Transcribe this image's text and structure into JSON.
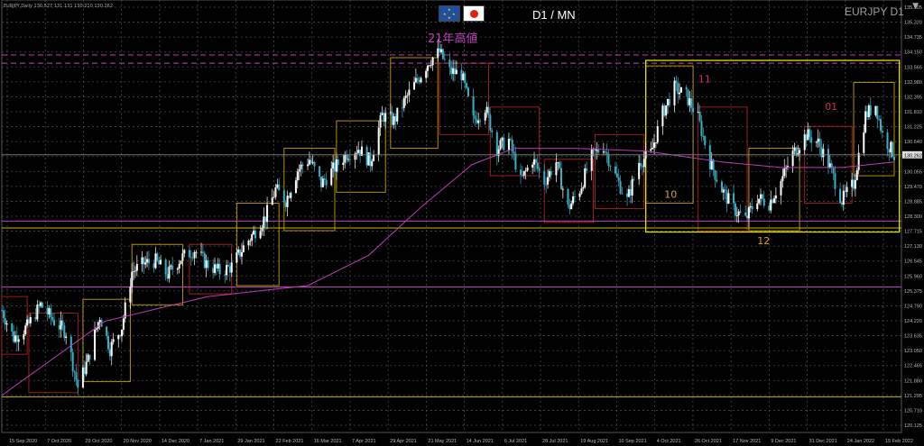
{
  "header": {
    "info_line": "EURJPY,Daily 130.527 131.131 130.210 130.262",
    "title": "D1 / MN",
    "symbol": "EURJPY D1",
    "window_control": "▼"
  },
  "colors": {
    "background": "#000000",
    "candle_bull": "#ffffff",
    "candle_bear": "#3ab0c8",
    "moving_average": "#c03ab8",
    "yellow_line": "#c8b400",
    "magenta_line": "#c040c0",
    "monthly_box": "#c8a000",
    "monthly_box_red": "#b02020",
    "range_box": "#e0e000",
    "grid": "#4a4a4a"
  },
  "chart_data": {
    "type": "candlestick",
    "symbol": "EURJPY",
    "timeframe": "Daily",
    "ylim": [
      120.15,
      135.9
    ],
    "x_range": [
      "2020-09-15",
      "2022-02-25"
    ],
    "y_ticks": [
      "135.905",
      "135.320",
      "134.735",
      "134.150",
      "133.565",
      "132.980",
      "132.395",
      "131.810",
      "131.225",
      "130.640",
      "130.262",
      "130.055",
      "129.470",
      "128.885",
      "128.300",
      "127.715",
      "127.130",
      "126.545",
      "125.960",
      "125.375",
      "124.790",
      "124.220",
      "123.635",
      "123.050",
      "122.465",
      "121.880",
      "121.295",
      "120.710",
      "120.125"
    ],
    "x_ticks": [
      "15 Sep 2020",
      "7 Oct 2020",
      "29 Oct 2020",
      "20 Nov 2020",
      "14 Dec 2020",
      "7 Jan 2021",
      "29 Jan 2021",
      "22 Feb 2021",
      "16 Mar 2021",
      "7 Apr 2021",
      "29 Apr 2021",
      "21 May 2021",
      "14 Jun 2021",
      "6 Jul 2021",
      "28 Jul 2021",
      "19 Aug 2021",
      "10 Sep 2021",
      "4 Oct 2021",
      "26 Oct 2021",
      "17 Nov 2021",
      "9 Dec 2021",
      "31 Dec 2021",
      "24 Jan 2022",
      "15 Feb 2022"
    ],
    "close_path": [
      [
        "2020-09-15",
        124.6
      ],
      [
        "2020-09-22",
        123.6
      ],
      [
        "2020-09-30",
        124.0
      ],
      [
        "2020-10-08",
        124.8
      ],
      [
        "2020-10-16",
        124.2
      ],
      [
        "2020-10-23",
        123.8
      ],
      [
        "2020-10-30",
        121.8
      ],
      [
        "2020-11-05",
        122.8
      ],
      [
        "2020-11-12",
        124.4
      ],
      [
        "2020-11-18",
        123.2
      ],
      [
        "2020-11-25",
        124.0
      ],
      [
        "2020-12-01",
        126.0
      ],
      [
        "2020-12-08",
        126.3
      ],
      [
        "2020-12-15",
        126.4
      ],
      [
        "2020-12-22",
        125.9
      ],
      [
        "2020-12-30",
        126.5
      ],
      [
        "2021-01-07",
        126.8
      ],
      [
        "2021-01-14",
        126.3
      ],
      [
        "2021-01-22",
        126.0
      ],
      [
        "2021-01-29",
        126.2
      ],
      [
        "2021-02-05",
        126.9
      ],
      [
        "2021-02-12",
        127.5
      ],
      [
        "2021-02-18",
        128.0
      ],
      [
        "2021-02-24",
        129.0
      ],
      [
        "2021-03-02",
        128.6
      ],
      [
        "2021-03-09",
        129.7
      ],
      [
        "2021-03-16",
        130.1
      ],
      [
        "2021-03-23",
        129.2
      ],
      [
        "2021-03-31",
        129.8
      ],
      [
        "2021-04-07",
        130.3
      ],
      [
        "2021-04-14",
        130.5
      ],
      [
        "2021-04-21",
        130.0
      ],
      [
        "2021-04-28",
        131.7
      ],
      [
        "2021-05-05",
        131.5
      ],
      [
        "2021-05-12",
        132.3
      ],
      [
        "2021-05-19",
        133.0
      ],
      [
        "2021-05-26",
        133.7
      ],
      [
        "2021-06-01",
        134.0
      ],
      [
        "2021-06-07",
        133.3
      ],
      [
        "2021-06-14",
        133.2
      ],
      [
        "2021-06-21",
        131.5
      ],
      [
        "2021-06-28",
        132.0
      ],
      [
        "2021-07-05",
        130.5
      ],
      [
        "2021-07-12",
        130.8
      ],
      [
        "2021-07-19",
        129.3
      ],
      [
        "2021-07-26",
        130.1
      ],
      [
        "2021-08-02",
        129.3
      ],
      [
        "2021-08-09",
        130.0
      ],
      [
        "2021-08-16",
        128.3
      ],
      [
        "2021-08-23",
        129.0
      ],
      [
        "2021-08-30",
        130.2
      ],
      [
        "2021-09-06",
        130.6
      ],
      [
        "2021-09-13",
        129.5
      ],
      [
        "2021-09-20",
        128.6
      ],
      [
        "2021-09-27",
        130.0
      ],
      [
        "2021-10-04",
        130.3
      ],
      [
        "2021-10-11",
        131.8
      ],
      [
        "2021-10-18",
        132.7
      ],
      [
        "2021-10-25",
        132.4
      ],
      [
        "2021-11-01",
        131.6
      ],
      [
        "2021-11-08",
        130.0
      ],
      [
        "2021-11-15",
        129.0
      ],
      [
        "2021-11-22",
        128.3
      ],
      [
        "2021-11-29",
        127.9
      ],
      [
        "2021-12-06",
        128.7
      ],
      [
        "2021-12-13",
        128.5
      ],
      [
        "2021-12-20",
        129.3
      ],
      [
        "2021-12-27",
        130.3
      ],
      [
        "2022-01-04",
        131.0
      ],
      [
        "2022-01-11",
        130.7
      ],
      [
        "2022-01-18",
        129.8
      ],
      [
        "2022-01-25",
        128.6
      ],
      [
        "2022-02-01",
        129.2
      ],
      [
        "2022-02-08",
        131.7
      ],
      [
        "2022-02-14",
        132.1
      ],
      [
        "2022-02-18",
        131.0
      ],
      [
        "2022-02-25",
        130.26
      ]
    ],
    "moving_average": [
      [
        "2020-09-15",
        121.5
      ],
      [
        "2020-11-15",
        124.2
      ],
      [
        "2021-01-15",
        125.1
      ],
      [
        "2021-03-15",
        125.5
      ],
      [
        "2021-04-20",
        126.6
      ],
      [
        "2021-05-20",
        128.3
      ],
      [
        "2021-06-20",
        129.9
      ],
      [
        "2021-07-15",
        130.5
      ],
      [
        "2021-08-20",
        130.5
      ],
      [
        "2021-10-01",
        130.4
      ],
      [
        "2021-11-15",
        130.0
      ],
      [
        "2021-12-20",
        129.8
      ],
      [
        "2022-01-25",
        129.8
      ],
      [
        "2022-02-25",
        130.0
      ]
    ],
    "current_price": 130.262,
    "horizontal_levels": [
      {
        "price": 133.9,
        "color": "magenta",
        "style": "dashed"
      },
      {
        "price": 133.6,
        "color": "magenta",
        "style": "dashed"
      },
      {
        "price": 127.85,
        "color": "magenta",
        "style": "solid"
      },
      {
        "price": 127.6,
        "color": "yellow",
        "style": "solid"
      },
      {
        "price": 125.45,
        "color": "magenta",
        "style": "solid"
      },
      {
        "price": 121.45,
        "color": "yellow",
        "style": "solid"
      }
    ],
    "range_box": {
      "x0": "2021-10-01",
      "x1": "2022-02-28",
      "y0": 127.45,
      "y1": 133.7
    },
    "monthly_boxes": [
      {
        "x0": "2020-09-15",
        "x1": "2020-09-30",
        "y0": 123.0,
        "y1": 125.1,
        "color": "red"
      },
      {
        "x0": "2020-10-01",
        "x1": "2020-10-30",
        "y0": 121.6,
        "y1": 124.5,
        "color": "red"
      },
      {
        "x0": "2020-11-02",
        "x1": "2020-11-30",
        "y0": 122.0,
        "y1": 125.0,
        "color": "gold"
      },
      {
        "x0": "2020-12-01",
        "x1": "2020-12-31",
        "y0": 124.8,
        "y1": 127.0,
        "color": "gold"
      },
      {
        "x0": "2021-01-04",
        "x1": "2021-01-29",
        "y0": 125.2,
        "y1": 127.0,
        "color": "red"
      },
      {
        "x0": "2021-02-01",
        "x1": "2021-02-26",
        "y0": 125.5,
        "y1": 128.5,
        "color": "gold"
      },
      {
        "x0": "2021-03-01",
        "x1": "2021-03-31",
        "y0": 127.5,
        "y1": 130.5,
        "color": "gold"
      },
      {
        "x0": "2021-04-01",
        "x1": "2021-04-30",
        "y0": 128.9,
        "y1": 131.5,
        "color": "gold"
      },
      {
        "x0": "2021-05-03",
        "x1": "2021-05-31",
        "y0": 130.5,
        "y1": 133.8,
        "color": "gold"
      },
      {
        "x0": "2021-06-01",
        "x1": "2021-06-30",
        "y0": 131.0,
        "y1": 133.6,
        "color": "red"
      },
      {
        "x0": "2021-07-01",
        "x1": "2021-07-30",
        "y0": 129.5,
        "y1": 132.0,
        "color": "red"
      },
      {
        "x0": "2021-08-02",
        "x1": "2021-08-31",
        "y0": 127.8,
        "y1": 130.1,
        "color": "red"
      },
      {
        "x0": "2021-09-01",
        "x1": "2021-09-30",
        "y0": 128.3,
        "y1": 131.0,
        "color": "red"
      },
      {
        "x0": "2021-10-01",
        "x1": "2021-10-29",
        "y0": 128.5,
        "y1": 133.5,
        "color": "gold"
      },
      {
        "x0": "2021-11-01",
        "x1": "2021-11-30",
        "y0": 127.5,
        "y1": 132.0,
        "color": "red"
      },
      {
        "x0": "2021-12-01",
        "x1": "2021-12-31",
        "y0": 127.5,
        "y1": 130.5,
        "color": "gold"
      },
      {
        "x0": "2022-01-03",
        "x1": "2022-01-31",
        "y0": 128.5,
        "y1": 131.3,
        "color": "red"
      },
      {
        "x0": "2022-02-01",
        "x1": "2022-02-25",
        "y0": 129.5,
        "y1": 132.9,
        "color": "gold"
      }
    ],
    "annotations": [
      {
        "text": "21年高値",
        "date": "2021-05-25",
        "price": 134.35,
        "color": "#c040c0"
      },
      {
        "text": "11",
        "date": "2021-11-01",
        "price": 132.9,
        "color": "#d03050"
      },
      {
        "text": "10",
        "date": "2021-10-12",
        "price": 128.7,
        "color": "#e0a020"
      },
      {
        "text": "01",
        "date": "2022-01-15",
        "price": 131.9,
        "color": "#d03050"
      },
      {
        "text": "12",
        "date": "2021-12-06",
        "price": 127.0,
        "color": "#e0a020"
      }
    ]
  }
}
